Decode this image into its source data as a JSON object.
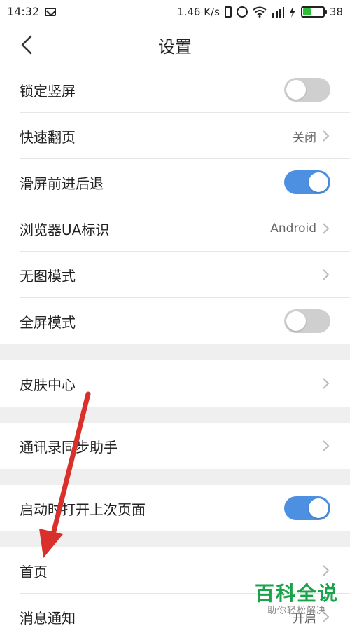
{
  "statusbar": {
    "time": "14:32",
    "speed": "1.46 K/s",
    "battery_text": "38",
    "battery_level": 0.38
  },
  "header": {
    "title": "设置"
  },
  "rows": [
    {
      "label": "锁定竖屏",
      "toggle": "off"
    },
    {
      "label": "快速翻页",
      "value": "关闭"
    },
    {
      "label": "滑屏前进后退",
      "toggle": "on"
    },
    {
      "label": "浏览器UA标识",
      "value": "Android"
    },
    {
      "label": "无图模式"
    },
    {
      "label": "全屏模式",
      "toggle": "off"
    },
    {
      "label": "皮肤中心"
    },
    {
      "label": "通讯录同步助手"
    },
    {
      "label": "启动时打开上次页面",
      "toggle": "on"
    },
    {
      "label": "首页"
    },
    {
      "label": "消息通知",
      "value": "开启"
    }
  ],
  "watermark": {
    "main": "百科全说",
    "sub": "助你轻松解决"
  },
  "colors": {
    "accent": "#4d8fe0",
    "annotation": "#d9302b",
    "watermark": "#1aa34a"
  }
}
